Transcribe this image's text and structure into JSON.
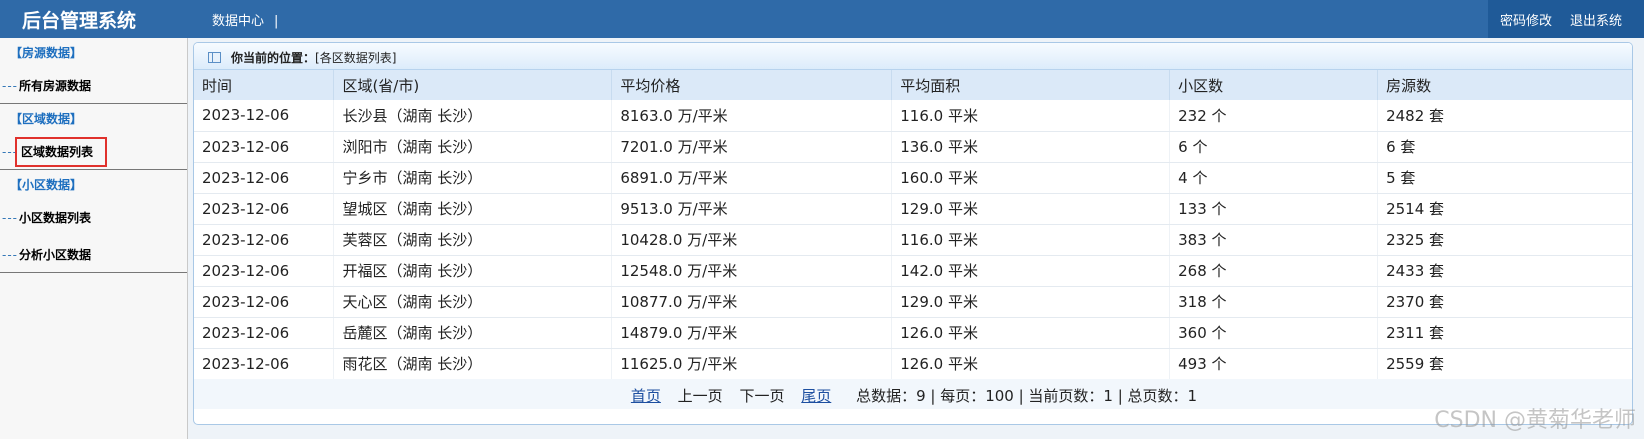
{
  "header": {
    "title": "后台管理系统",
    "nav_center": "数据中心",
    "nav_sep": "|",
    "change_password": "密码修改",
    "logout": "退出系统"
  },
  "sidebar": {
    "sections": [
      {
        "heading": "【房源数据】",
        "items": [
          {
            "label": "所有房源数据",
            "dash": "---"
          }
        ]
      },
      {
        "heading": "【区域数据】",
        "items": [
          {
            "label": "区域数据列表",
            "dash": "---"
          }
        ]
      },
      {
        "heading": "【小区数据】",
        "items": [
          {
            "label": "小区数据列表",
            "dash": "---"
          },
          {
            "label": "分析小区数据",
            "dash": "---"
          }
        ]
      }
    ]
  },
  "breadcrumb": {
    "label": "你当前的位置：",
    "location": "[各区数据列表]"
  },
  "table": {
    "headers": [
      "时间",
      "区域(省/市)",
      "平均价格",
      "平均面积",
      "小区数",
      "房源数"
    ],
    "rows": [
      [
        "2023-12-06",
        "长沙县（湖南 长沙）",
        "8163.0 万/平米",
        "116.0 平米",
        "232 个",
        "2482 套"
      ],
      [
        "2023-12-06",
        "浏阳市（湖南 长沙）",
        "7201.0 万/平米",
        "136.0 平米",
        "6 个",
        "6 套"
      ],
      [
        "2023-12-06",
        "宁乡市（湖南 长沙）",
        "6891.0 万/平米",
        "160.0 平米",
        "4 个",
        "5 套"
      ],
      [
        "2023-12-06",
        "望城区（湖南 长沙）",
        "9513.0 万/平米",
        "129.0 平米",
        "133 个",
        "2514 套"
      ],
      [
        "2023-12-06",
        "芙蓉区（湖南 长沙）",
        "10428.0 万/平米",
        "116.0 平米",
        "383 个",
        "2325 套"
      ],
      [
        "2023-12-06",
        "开福区（湖南 长沙）",
        "12548.0 万/平米",
        "142.0 平米",
        "268 个",
        "2433 套"
      ],
      [
        "2023-12-06",
        "天心区（湖南 长沙）",
        "10877.0 万/平米",
        "129.0 平米",
        "318 个",
        "2370 套"
      ],
      [
        "2023-12-06",
        "岳麓区（湖南 长沙）",
        "14879.0 万/平米",
        "126.0 平米",
        "360 个",
        "2311 套"
      ],
      [
        "2023-12-06",
        "雨花区（湖南 长沙）",
        "11625.0 万/平米",
        "126.0 平米",
        "493 个",
        "2559 套"
      ]
    ]
  },
  "pager": {
    "first": "首页",
    "prev": "上一页",
    "next": "下一页",
    "last": "尾页",
    "stats": "总数据：9 | 每页：100 | 当前页数：1 | 总页数：1"
  },
  "watermark": "CSDN @黄菊华老师"
}
